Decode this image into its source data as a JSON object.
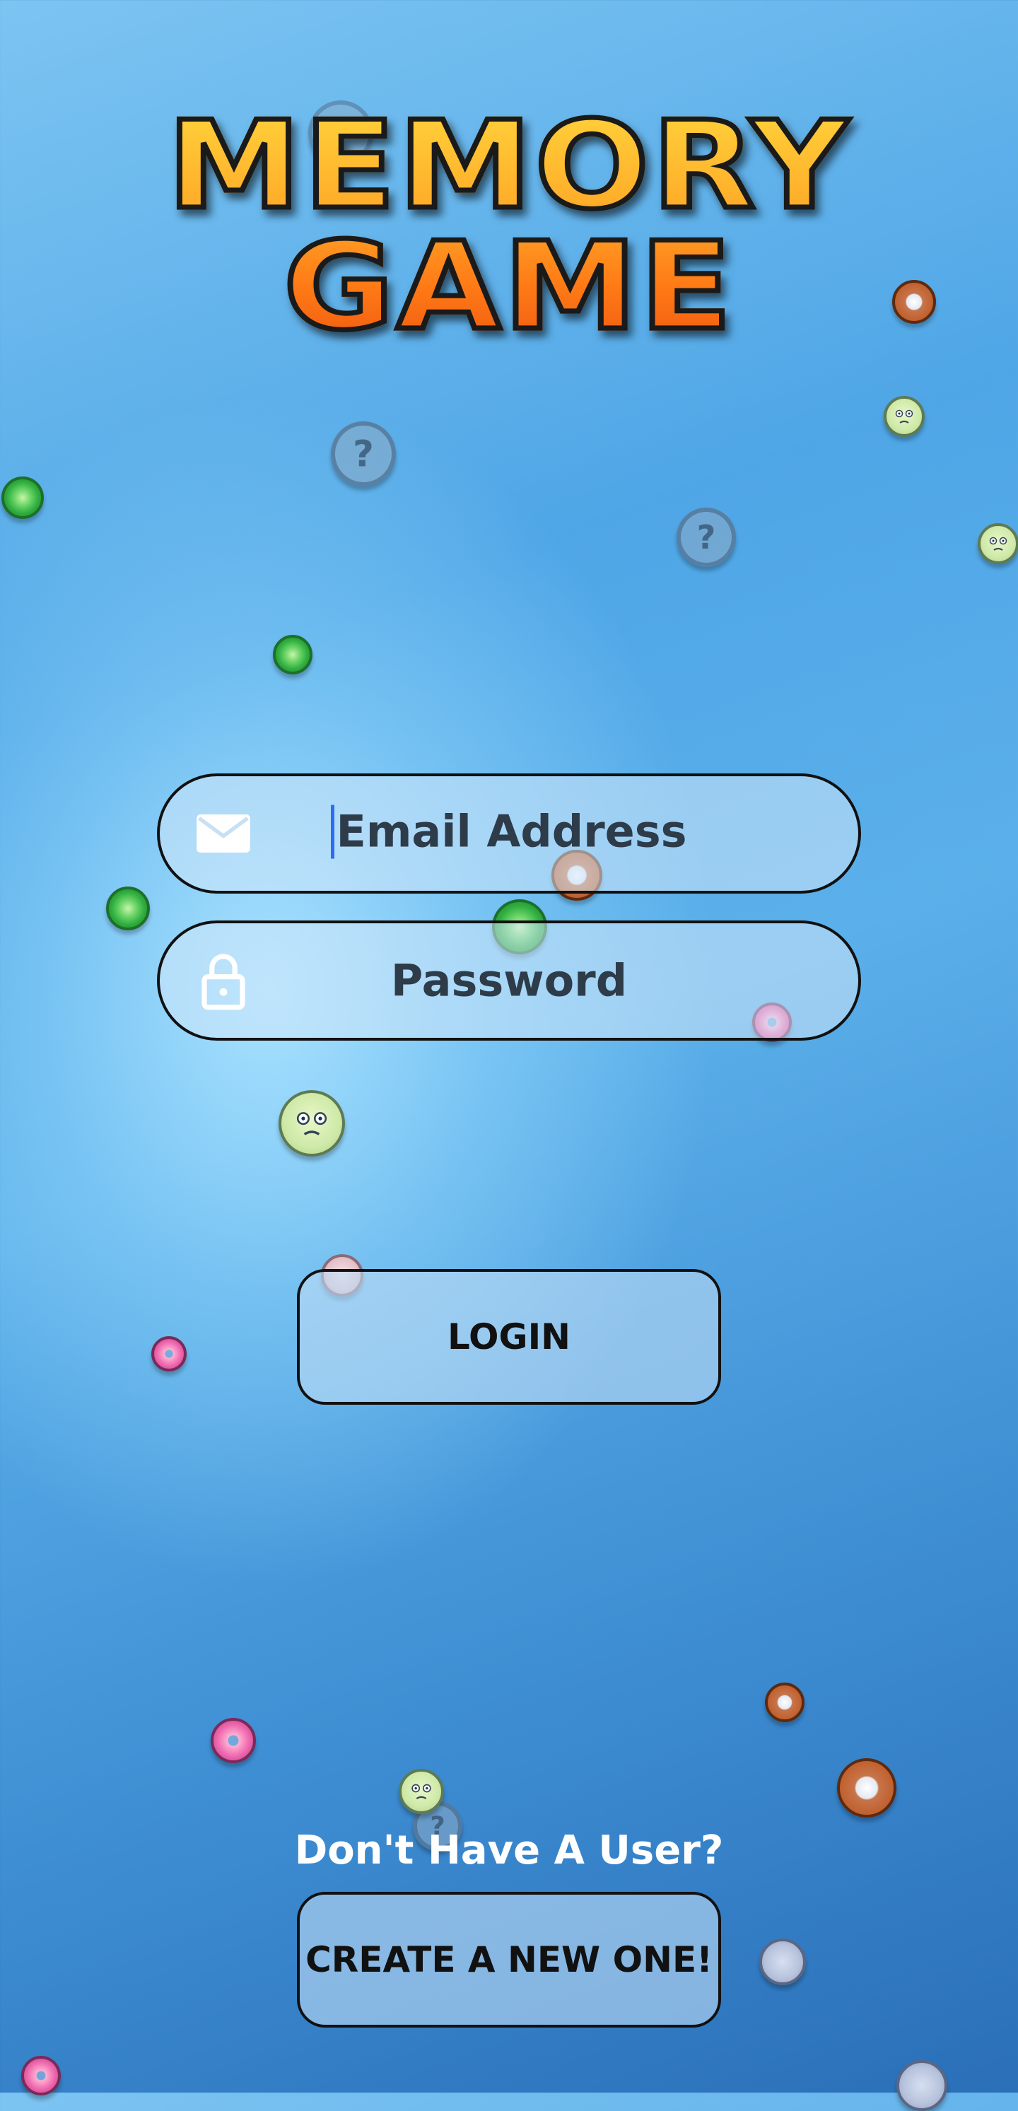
{
  "app": {
    "title": "MEMORY GAME"
  },
  "login_form": {
    "email": {
      "placeholder": "Email Address",
      "icon": "mail-icon"
    },
    "password": {
      "placeholder": "Password",
      "icon": "lock-icon"
    },
    "login_label": "LOGIN"
  },
  "signup": {
    "prompt": "Don't Have A User?",
    "create_label": "CREATE A NEW ONE!"
  },
  "colors": {
    "title_fill_top": "#ffd23a",
    "title_fill_bottom": "#f05a10",
    "background_light": "#a9e2ff",
    "background_dark": "#2a6fb8",
    "caret": "#2d6cf0"
  },
  "decor_tokens": [
    "question-mark-token",
    "green-swirl-token",
    "orange-face-token",
    "green-face-token",
    "pink-donut-token"
  ]
}
